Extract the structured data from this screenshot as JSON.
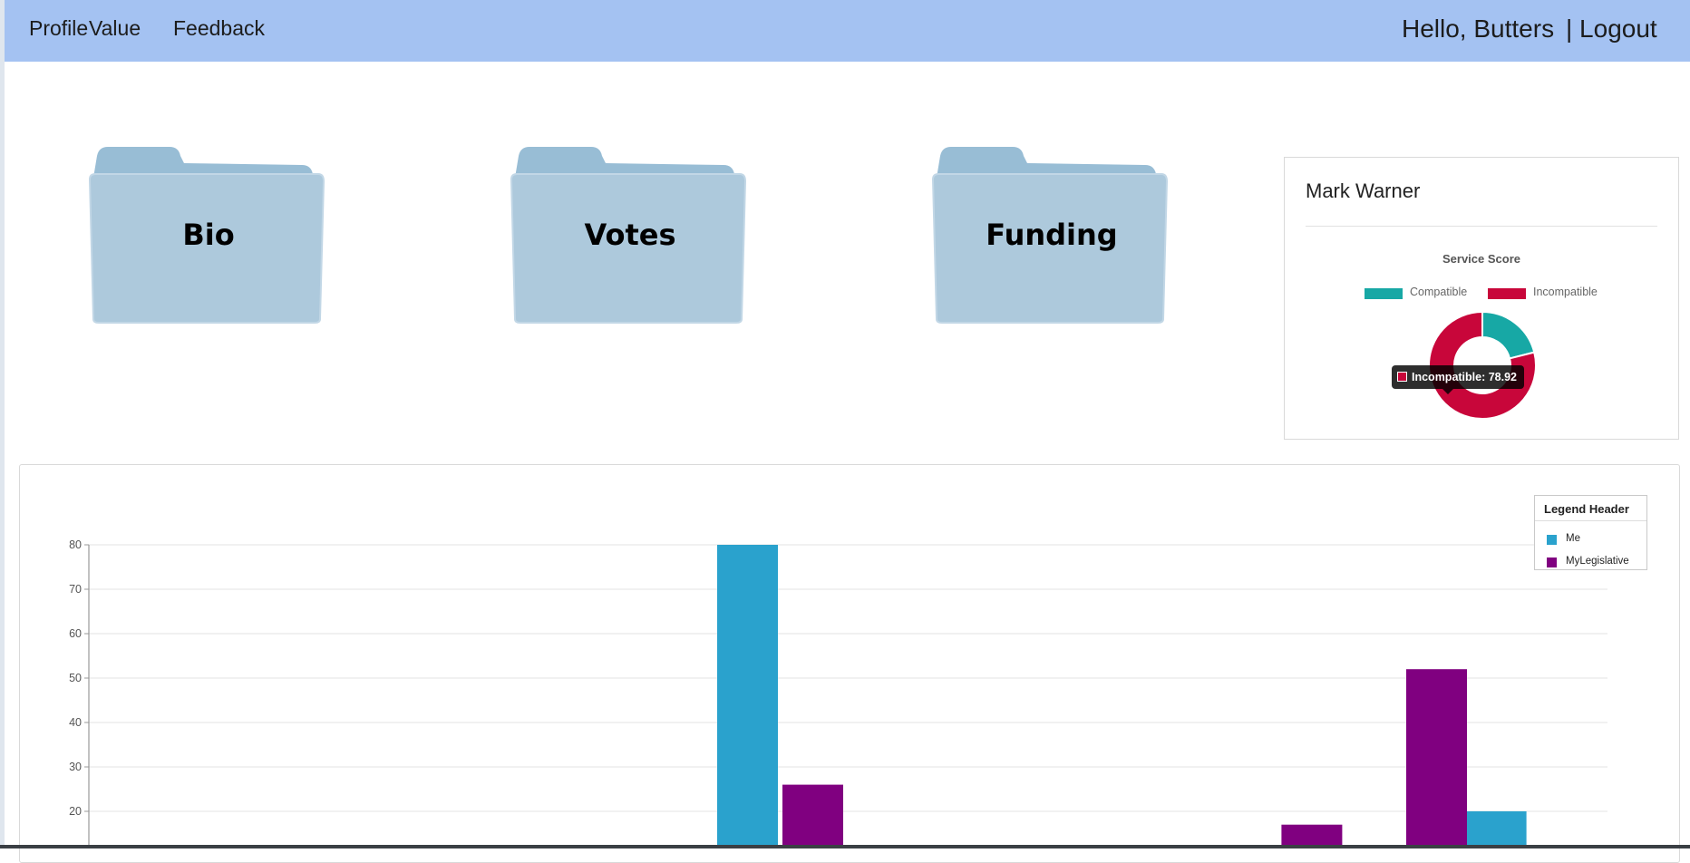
{
  "nav": {
    "links": [
      "Profile",
      "Value",
      "Feedback"
    ],
    "greeting": "Hello, Butters",
    "logout": "| Logout"
  },
  "folders": [
    "Bio",
    "Votes",
    "Funding"
  ],
  "colors": {
    "nav_bg": "#a4c2f2",
    "folder": "#adc9dc",
    "compatible": "#17a8a5",
    "incompatible": "#c8063a",
    "me": "#2aa2cd",
    "my_legislative": "#800080"
  },
  "score_card": {
    "name": "Mark Warner",
    "title": "Service Score",
    "legend": [
      "Compatible",
      "Incompatible"
    ],
    "tooltip": "Incompatible: 78.92",
    "donut": {
      "Compatible": 21.08,
      "Incompatible": 78.92
    }
  },
  "chart_data": {
    "type": "bar",
    "legend_title": "Legend Header",
    "legend_position": "top-right",
    "grid": true,
    "ylim_visible": [
      15,
      80
    ],
    "y_ticks": [
      20,
      30,
      40,
      50,
      60,
      70,
      80
    ],
    "series": [
      {
        "name": "Me",
        "bars": [
          {
            "group": 5,
            "value": 80
          },
          {
            "group": 11,
            "value": 20
          }
        ]
      },
      {
        "name": "MyLegislative",
        "bars": [
          {
            "group": 5,
            "value": 26
          },
          {
            "group": 9,
            "value": 17
          },
          {
            "group": 10,
            "value": 52
          }
        ]
      }
    ]
  }
}
